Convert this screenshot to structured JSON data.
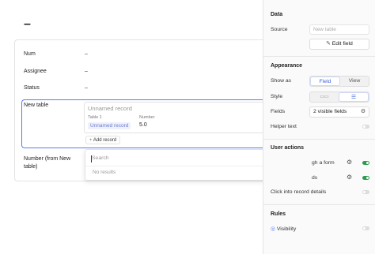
{
  "page": {
    "title": "–"
  },
  "record_fields": [
    {
      "label": "Num",
      "value": "–"
    },
    {
      "label": "Assignee",
      "value": "–"
    },
    {
      "label": "Status",
      "value": "–"
    },
    {
      "label": "New table",
      "value": ""
    },
    {
      "label": "Number (from New\ntable)",
      "value": ""
    }
  ],
  "linked_record": {
    "name_placeholder": "Unnamed record",
    "col1_header": "Table 1",
    "col1_value": "Unnamed record",
    "col2_header": "Number",
    "col2_value": "5.0",
    "add_label": "Add record"
  },
  "search_dropdown": {
    "placeholder": "Search",
    "empty_text": "No results"
  },
  "panel": {
    "data": {
      "title": "Data",
      "source_label": "Source",
      "source_value": "New table",
      "edit_field_label": "Edit field"
    },
    "appearance": {
      "title": "Appearance",
      "show_as_label": "Show as",
      "show_as_options": [
        "Field",
        "View"
      ],
      "show_as_selected": "Field",
      "style_label": "Style",
      "fields_label": "Fields",
      "fields_value": "2 visible fields",
      "helper_text_label": "Helper text"
    },
    "user_actions": {
      "title": "User actions",
      "item1_label": "gh a form",
      "item2_label": "ds",
      "click_into_label": "Click into record details"
    },
    "rules": {
      "title": "Rules",
      "visibility_label": "Visibility"
    }
  },
  "colors": {
    "accent": "#3b5bdb",
    "toggle_on": "#2d9b4e"
  }
}
